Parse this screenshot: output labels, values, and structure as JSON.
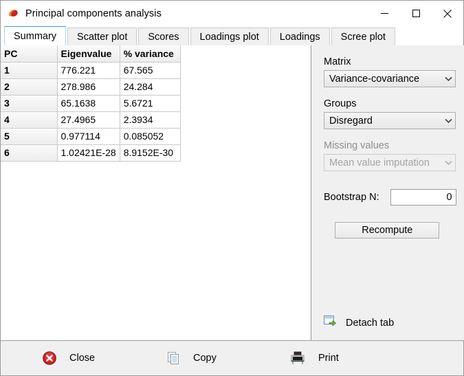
{
  "window": {
    "title": "Principal components analysis",
    "app_icon": "past-shell-icon",
    "controls": {
      "minimize": "minimize-button",
      "maximize": "maximize-button",
      "close": "close-window-button"
    }
  },
  "tabs": [
    {
      "label": "Summary",
      "selected": true
    },
    {
      "label": "Scatter plot",
      "selected": false
    },
    {
      "label": "Scores",
      "selected": false
    },
    {
      "label": "Loadings plot",
      "selected": false
    },
    {
      "label": "Loadings",
      "selected": false
    },
    {
      "label": "Scree plot",
      "selected": false
    }
  ],
  "table": {
    "headers": [
      "PC",
      "Eigenvalue",
      "% variance"
    ],
    "rows": [
      {
        "pc": "1",
        "eigenvalue": "776.221",
        "variance": "67.565"
      },
      {
        "pc": "2",
        "eigenvalue": "278.986",
        "variance": "24.284"
      },
      {
        "pc": "3",
        "eigenvalue": "65.1638",
        "variance": "5.6721"
      },
      {
        "pc": "4",
        "eigenvalue": "27.4965",
        "variance": "2.3934"
      },
      {
        "pc": "5",
        "eigenvalue": "0.977114",
        "variance": "0.085052"
      },
      {
        "pc": "6",
        "eigenvalue": "1.02421E-28",
        "variance": "8.9152E-30"
      }
    ]
  },
  "panel": {
    "matrix": {
      "label": "Matrix",
      "value": "Variance-covariance",
      "disabled": false
    },
    "groups": {
      "label": "Groups",
      "value": "Disregard",
      "disabled": false
    },
    "missing_values": {
      "label": "Missing values",
      "value": "Mean value imputation",
      "disabled": true
    },
    "bootstrap": {
      "label": "Bootstrap N:",
      "value": "0"
    },
    "recompute_label": "Recompute",
    "detach_label": "Detach tab"
  },
  "toolbar": [
    {
      "label": "Close",
      "icon": "close-circle-icon"
    },
    {
      "label": "Copy",
      "icon": "copy-pages-icon"
    },
    {
      "label": "Print",
      "icon": "printer-icon"
    }
  ],
  "colors": {
    "accent": "#3399dd",
    "window_bg": "#f0f0f0",
    "content_bg": "#ffffff",
    "close_icon": "#cc1f1f",
    "detach_arrow": "#6aa832"
  }
}
